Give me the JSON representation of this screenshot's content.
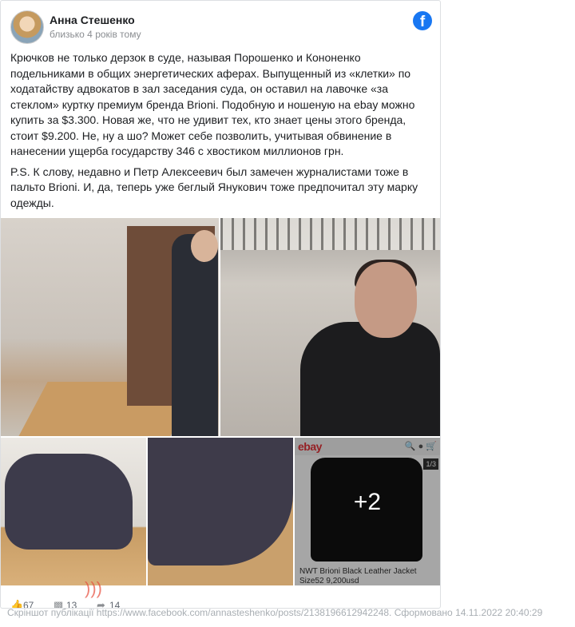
{
  "post": {
    "author": "Анна Стешенко",
    "time": "близько 4 років тому",
    "paragraphs": [
      "Крючков не только дерзок в суде, называя Порошенко и Кононенко подельниками в общих энергетических аферах. Выпущенный из «клетки» по ходатайству адвокатов в зал заседания суда, он оставил на лавочке «за стеклом» куртку премиум бренда Brioni. Подобную и ношеную на ebay можно купить за $3.300. Новая же, что не удивит тех, кто знает цены этого бренда, стоит $9.200. Не, ну а шо? Может себе позволить, учитывая обвинение в нанесении ущерба государству 346 с хвостиком миллионов грн.",
      "P.S. К слову, недавно и Петр Алексеевич был замечен журналистами тоже в пальто Brioni. И, да, теперь уже беглый Янукович тоже предпочитал эту марку одежды."
    ]
  },
  "ebay": {
    "logo": "ebay",
    "counter": "1/3",
    "caption": "NWT Brioni Black Leather Jacket Size52 9,200usd"
  },
  "gallery": {
    "more": "+2"
  },
  "stats": {
    "likes": "67",
    "comments": "13",
    "shares": "14"
  },
  "watermark": "Скріншот публікації https://www.facebook.com/annasteshenko/posts/2138196612942248. Сформовано 14.11.2022 20:40:29",
  "icons": [
    "facebook-icon",
    "like-icon",
    "comment-icon",
    "share-icon",
    "search-icon",
    "user-icon",
    "cart-icon"
  ]
}
